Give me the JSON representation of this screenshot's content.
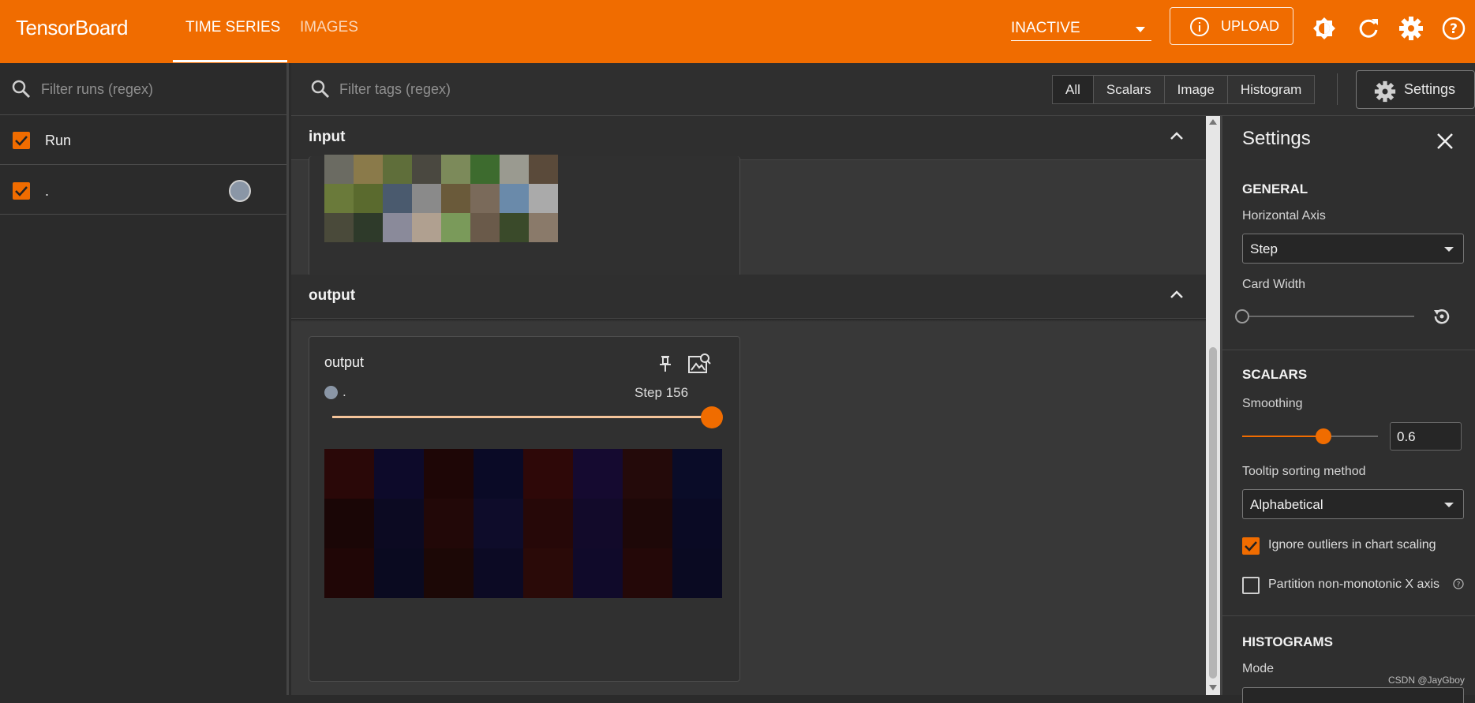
{
  "header": {
    "brand": "TensorBoard",
    "tabs": [
      {
        "label": "TIME SERIES",
        "active": true
      },
      {
        "label": "IMAGES",
        "active": false
      }
    ],
    "reload_state": "INACTIVE",
    "upload_label": "UPLOAD",
    "icons": [
      "info-icon",
      "theme-toggle-icon",
      "refresh-icon",
      "gear-icon",
      "help-icon"
    ],
    "colors": {
      "bar": "#f06c00",
      "text": "#ffffff"
    }
  },
  "runs": {
    "filter_placeholder": "Filter runs (regex)",
    "items": [
      {
        "label": "Run",
        "checked": true
      },
      {
        "label": ".",
        "checked": true,
        "color": "#8a96a6"
      }
    ]
  },
  "main": {
    "filter_placeholder": "Filter tags (regex)",
    "type_filters": [
      {
        "label": "All",
        "active": true
      },
      {
        "label": "Scalars",
        "active": false
      },
      {
        "label": "Image",
        "active": false
      },
      {
        "label": "Histogram",
        "active": false
      }
    ],
    "settings_button_label": "Settings",
    "sections": [
      {
        "title": "input"
      },
      {
        "title": "output"
      }
    ],
    "output_card": {
      "title": "output",
      "run_label": ".",
      "step_label": "Step 156",
      "step_slider_fraction": 1.0
    }
  },
  "settings": {
    "title": "Settings",
    "general_heading": "GENERAL",
    "horizontal_axis_label": "Horizontal Axis",
    "horizontal_axis_value": "Step",
    "card_width_label": "Card Width",
    "card_width_fraction": 0.0,
    "scalars_heading": "SCALARS",
    "smoothing_label": "Smoothing",
    "smoothing_value": "0.6",
    "smoothing_fraction": 0.6,
    "tooltip_label": "Tooltip sorting method",
    "tooltip_value": "Alphabetical",
    "ignore_outliers_label": "Ignore outliers in chart scaling",
    "ignore_outliers_checked": true,
    "partition_label": "Partition non-monotonic X axis",
    "partition_checked": false,
    "histograms_heading": "HISTOGRAMS",
    "mode_label": "Mode"
  },
  "footer": {
    "watermark": "CSDN @JayGboy"
  }
}
